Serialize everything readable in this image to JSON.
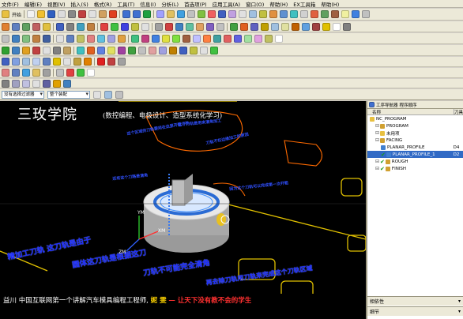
{
  "menu": [
    "文件(F)",
    "编辑(E)",
    "视图(V)",
    "插入(S)",
    "格式(R)",
    "工具(T)",
    "信息(I)",
    "分析(L)",
    "首选项(P)",
    "应用工具(A)",
    "窗口(O)",
    "帮助(H)",
    "EX工具箱",
    "帮助(H)"
  ],
  "toolbar": {
    "start_label": "开始",
    "select_filter": "没有选择过滤器",
    "assembly_filter": "整个装配"
  },
  "overlay": {
    "title": "三玫学院",
    "subtitle": "(数控编程、电极设计、造型系统化学习)",
    "bottom_prefix": "益川",
    "bottom_main": "中国互联网第一个讲解汽车模具编程工程师,",
    "bottom_name": "妮 雯",
    "bottom_slogan": "— 让天下没有教不会的学生"
  },
  "annotations": {
    "a1": "这个区域的刀轨要用在这里开粗刀轨",
    "a2": "这个刀轨是用来清角加工",
    "a3": "刀轨不在边缘加工的原因",
    "a4": "还有这个刀路是清角",
    "a5": "因为这个刀轨可以完成第一次开粗",
    "big1": "精加工刀轨 这刀轨是由于",
    "big2": "圆体这刀轨是根据这刀",
    "big3": "刀轨不可能完全清角",
    "big4": "再去除刀轨用刀轨来完成这个刀轨区域"
  },
  "axes": {
    "x": "XM",
    "y": "YM",
    "z": "ZM"
  },
  "navigator": {
    "tabs": [
      "工序导航器",
      "程序顺序"
    ],
    "col_name": "名称",
    "col_tool": "刀具",
    "items": [
      {
        "label": "NC_PROGRAM",
        "value": "",
        "indent": 0,
        "icon": "folder",
        "check": false,
        "selected": false
      },
      {
        "label": "PROGRAM",
        "value": "",
        "indent": 1,
        "icon": "program",
        "check": false,
        "selected": false
      },
      {
        "label": "未用项",
        "value": "",
        "indent": 1,
        "icon": "folder",
        "check": false,
        "selected": false
      },
      {
        "label": "FACING",
        "value": "",
        "indent": 1,
        "icon": "program",
        "check": false,
        "selected": false
      },
      {
        "label": "PLANAR_PROFILE",
        "value": "D4",
        "indent": 2,
        "icon": "operation",
        "check": false,
        "selected": false
      },
      {
        "label": "PLANAR_PROFILE_1",
        "value": "D2",
        "indent": 2,
        "icon": "operation",
        "check": true,
        "selected": true
      },
      {
        "label": "ROUGH",
        "value": "",
        "indent": 1,
        "icon": "program",
        "check": true,
        "selected": false
      },
      {
        "label": "FINISH",
        "value": "",
        "indent": 1,
        "icon": "program",
        "check": true,
        "selected": false
      }
    ],
    "bottom1": "相依性",
    "bottom2": "细节"
  }
}
